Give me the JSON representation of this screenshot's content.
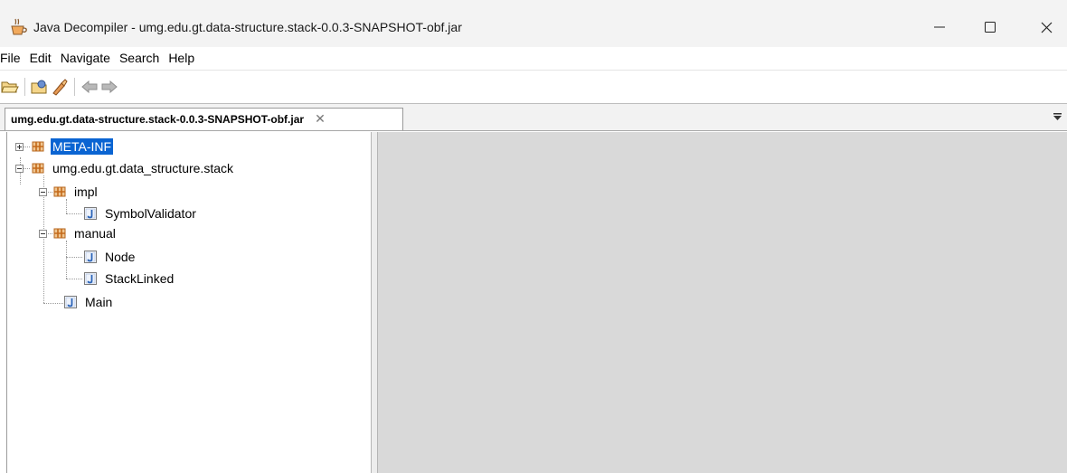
{
  "window": {
    "title": "Java Decompiler - umg.edu.gt.data-structure.stack-0.0.3-SNAPSHOT-obf.jar",
    "controls": {
      "minimize": "—",
      "maximize": "☐",
      "close": "✕"
    }
  },
  "menu": {
    "items": [
      "File",
      "Edit",
      "Navigate",
      "Search",
      "Help"
    ]
  },
  "toolbar": {
    "buttons": [
      "open-file-icon",
      "open-type-icon",
      "search-icon",
      "back-arrow-icon",
      "forward-arrow-icon"
    ]
  },
  "tabs": [
    {
      "label": "umg.edu.gt.data-structure.stack-0.0.3-SNAPSHOT-obf.jar",
      "close": "✕",
      "active": true
    }
  ],
  "tree": {
    "nodes": [
      {
        "label": "META-INF",
        "type": "package",
        "selected": true,
        "expanded": false
      },
      {
        "label": "umg.edu.gt.data_structure.stack",
        "type": "package",
        "expanded": true
      },
      {
        "label": "impl",
        "type": "package",
        "expanded": true
      },
      {
        "label": "SymbolValidator",
        "type": "class"
      },
      {
        "label": "manual",
        "type": "package",
        "expanded": true
      },
      {
        "label": "Node",
        "type": "class"
      },
      {
        "label": "StackLinked",
        "type": "class"
      },
      {
        "label": "Main",
        "type": "class"
      }
    ]
  },
  "colors": {
    "selection": "#0a64d2",
    "content_background": "#d9d9d9",
    "package_icon": "#c46a1a",
    "class_icon": "#2a63b8"
  }
}
